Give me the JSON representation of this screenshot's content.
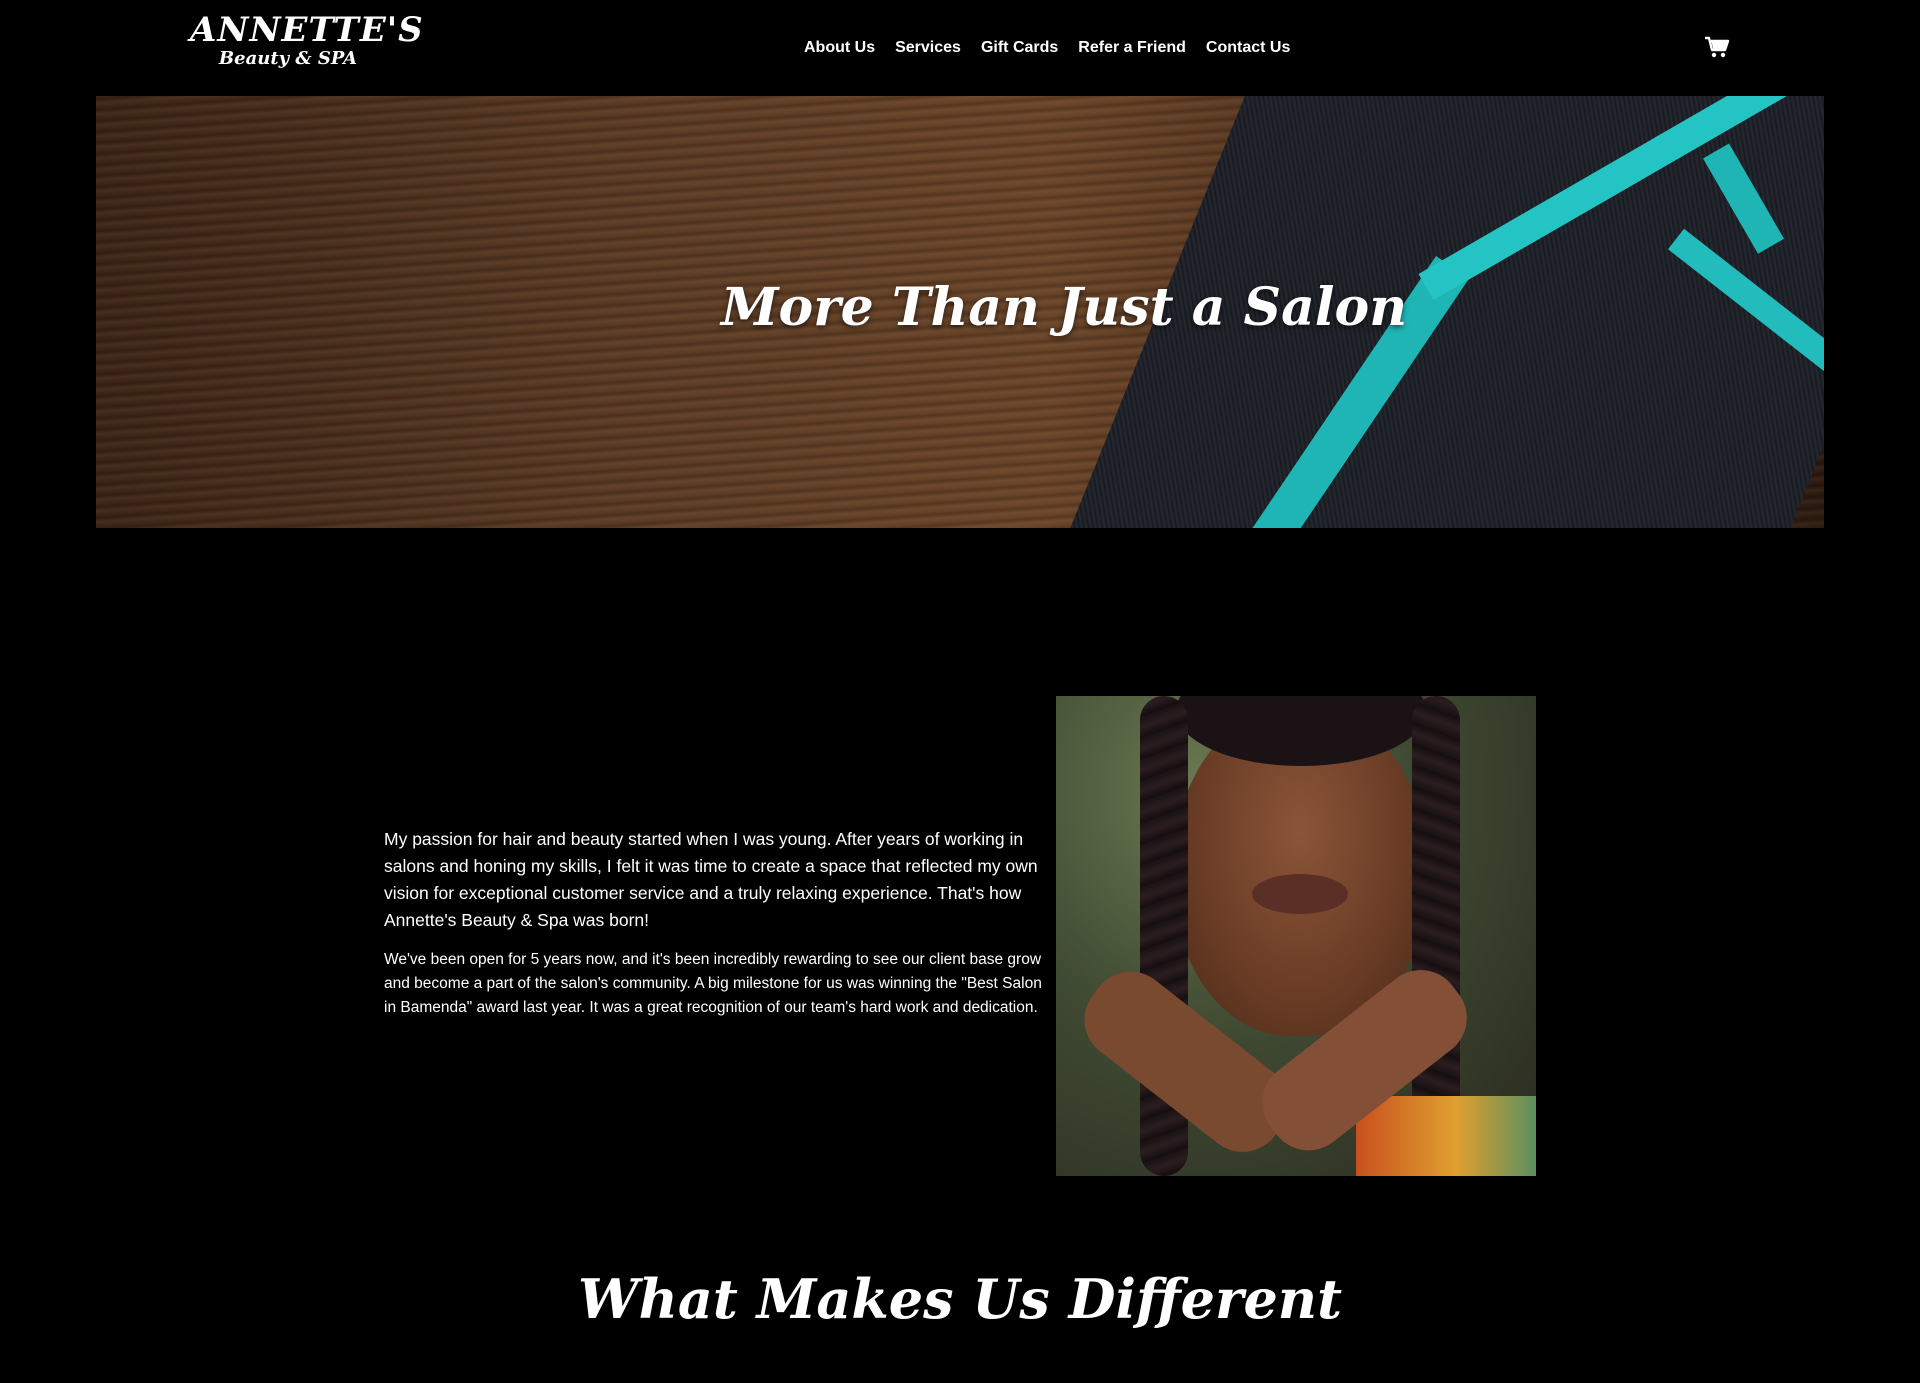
{
  "brand": {
    "title": "ANNETTE'S",
    "subtitle": "Beauty & SPA"
  },
  "nav": {
    "items": [
      {
        "label": "About Us"
      },
      {
        "label": "Services"
      },
      {
        "label": "Gift Cards"
      },
      {
        "label": "Refer a Friend"
      },
      {
        "label": "Contact Us"
      }
    ],
    "cart_icon": "cart-icon"
  },
  "hero": {
    "title": "More Than Just a Salon",
    "image": "gift-box-on-wooden-table"
  },
  "about": {
    "paragraph1": "My passion for hair and beauty started when I was young. After years of working in salons and honing my skills, I felt it was time to create a space that reflected my own vision for exceptional customer service and a truly relaxing experience. That's how Annette's Beauty & Spa was born!",
    "paragraph2": "We've been open for 5 years now, and it's been incredibly rewarding to see our client base grow and become a part of the salon's community. A big milestone for us was winning the \"Best Salon in Bamenda\" award last year. It was a great recognition of our team's hard work and dedication.",
    "image": "woman-portrait"
  },
  "different": {
    "title": "What Makes Us Different"
  },
  "colors": {
    "background": "#000000",
    "text": "#ffffff",
    "ribbon": "#1fb5b5"
  }
}
